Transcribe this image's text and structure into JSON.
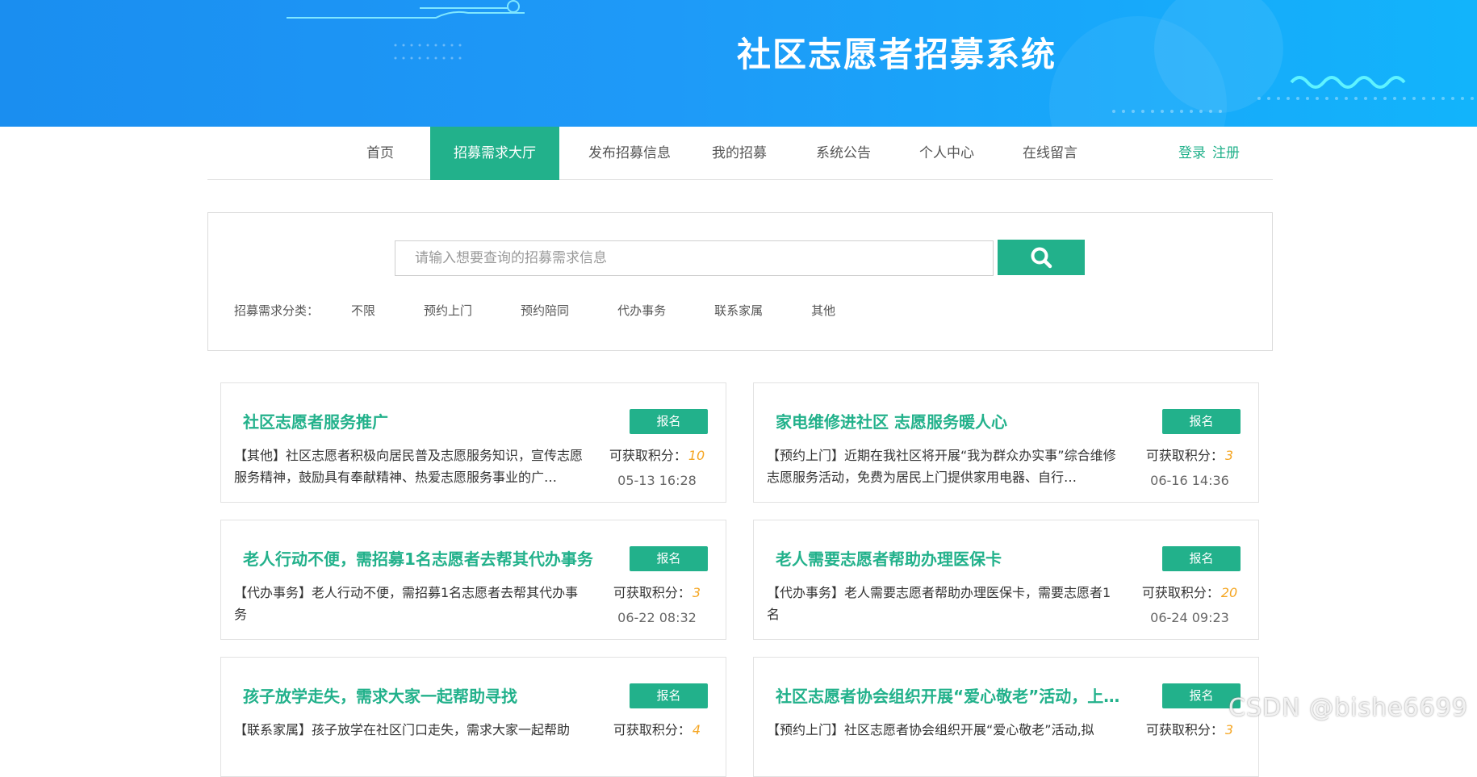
{
  "banner": {
    "title": "社区志愿者招募系统"
  },
  "nav": {
    "items": [
      {
        "label": "首页"
      },
      {
        "label": "招募需求大厅"
      },
      {
        "label": "发布招募信息"
      },
      {
        "label": "我的招募"
      },
      {
        "label": "系统公告"
      },
      {
        "label": "个人中心"
      },
      {
        "label": "在线留言"
      }
    ],
    "active_index": 1,
    "login_label": "登录",
    "register_label": "注册"
  },
  "search": {
    "placeholder": "请输入想要查询的招募需求信息",
    "icon": "search-icon",
    "category_label": "招募需求分类：",
    "categories": [
      "不限",
      "预约上门",
      "预约陪同",
      "代办事务",
      "联系家属",
      "其他"
    ]
  },
  "cards": [
    {
      "title": "社区志愿者服务推广",
      "button": "报名",
      "desc": "【其他】社区志愿者积极向居民普及志愿服务知识，宣传志愿服务精神，鼓励具有奉献精神、热爱志愿服务事业的广…",
      "points_label": "可获取积分：",
      "points": "10",
      "time": "05-13 16:28"
    },
    {
      "title": "家电维修进社区 志愿服务暖人心",
      "button": "报名",
      "desc": "【预约上门】近期在我社区将开展“我为群众办实事”综合维修志愿服务活动，免费为居民上门提供家用电器、自行…",
      "points_label": "可获取积分：",
      "points": "3",
      "time": "06-16 14:36"
    },
    {
      "title": "老人行动不便，需招募1名志愿者去帮其代办事务",
      "button": "报名",
      "desc": "【代办事务】老人行动不便，需招募1名志愿者去帮其代办事务",
      "points_label": "可获取积分：",
      "points": "3",
      "time": "06-22 08:32"
    },
    {
      "title": "老人需要志愿者帮助办理医保卡",
      "button": "报名",
      "desc": "【代办事务】老人需要志愿者帮助办理医保卡，需要志愿者1名",
      "points_label": "可获取积分：",
      "points": "20",
      "time": "06-24 09:23"
    },
    {
      "title": "孩子放学走失，需求大家一起帮助寻找",
      "button": "报名",
      "desc": "【联系家属】孩子放学在社区门口走失，需求大家一起帮助",
      "points_label": "可获取积分：",
      "points": "4",
      "time": ""
    },
    {
      "title": "社区志愿者协会组织开展“爱心敬老”活动，上门…",
      "button": "报名",
      "desc": "【预约上门】社区志愿者协会组织开展“爱心敬老”活动,拟",
      "points_label": "可获取积分：",
      "points": "3",
      "time": ""
    }
  ],
  "watermark": "CSDN @bishe6699",
  "colors": {
    "accent": "#22b18b",
    "banner": "#1e9af8",
    "points": "#f5a623"
  }
}
